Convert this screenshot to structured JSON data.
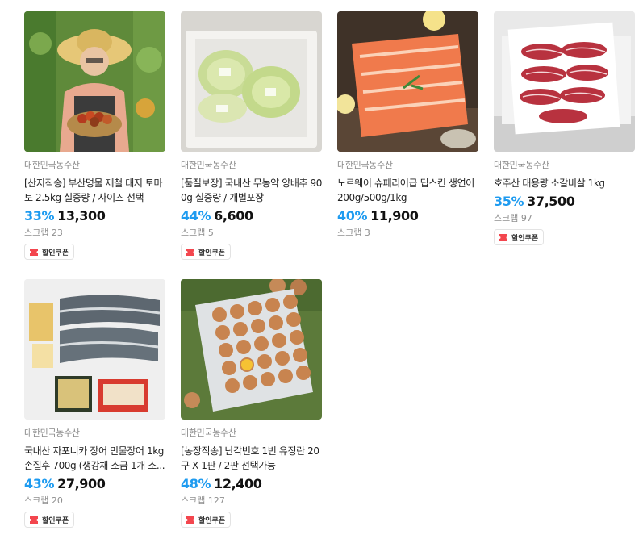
{
  "colors": {
    "discount": "#1e9bf0",
    "coupon_icon": "#f3464e"
  },
  "products": [
    {
      "seller": "대한민국농수산",
      "title": "[산지직송] 부산명물 제철 대저 토마토 2.5kg 실중량 / 사이즈 선택",
      "discount_rate": "33%",
      "price": "13,300",
      "scrap": "스크랩 23",
      "coupon": "할인쿠폰",
      "image": "farmer-with-tomato-basket"
    },
    {
      "seller": "대한민국농수산",
      "title": "[품질보장] 국내산 무농약 양배추 900g 실중량 / 개별포장",
      "discount_rate": "44%",
      "price": "6,600",
      "scrap": "스크랩 5",
      "coupon": "할인쿠폰",
      "image": "cabbages-in-styrofoam-box"
    },
    {
      "seller": "대한민국농수산",
      "title": "노르웨이 슈페리어급 딥스킨 생연어 200g/500g/1kg",
      "discount_rate": "40%",
      "price": "11,900",
      "scrap": "스크랩 3",
      "image": "salmon-fillet"
    },
    {
      "seller": "대한민국농수산",
      "title": "호주산 대용량 소갈비살 1kg",
      "discount_rate": "35%",
      "price": "37,500",
      "scrap": "스크랩 97",
      "coupon": "할인쿠폰",
      "image": "beef-rib-plate"
    },
    {
      "seller": "대한민국농수산",
      "title": "국내산 자포니카 장어 민물장어 1kg 손질후 700g (생강채 소금 1개 소...",
      "discount_rate": "43%",
      "price": "27,900",
      "scrap": "스크랩 20",
      "coupon": "할인쿠폰",
      "image": "eel-fillets-with-sauce"
    },
    {
      "seller": "대한민국농수산",
      "title": "[농장직송] 난각번호 1번 유정란 20구 X 1판 / 2판 선택가능",
      "discount_rate": "48%",
      "price": "12,400",
      "scrap": "스크랩 127",
      "coupon": "할인쿠폰",
      "image": "egg-tray-on-grass"
    }
  ]
}
